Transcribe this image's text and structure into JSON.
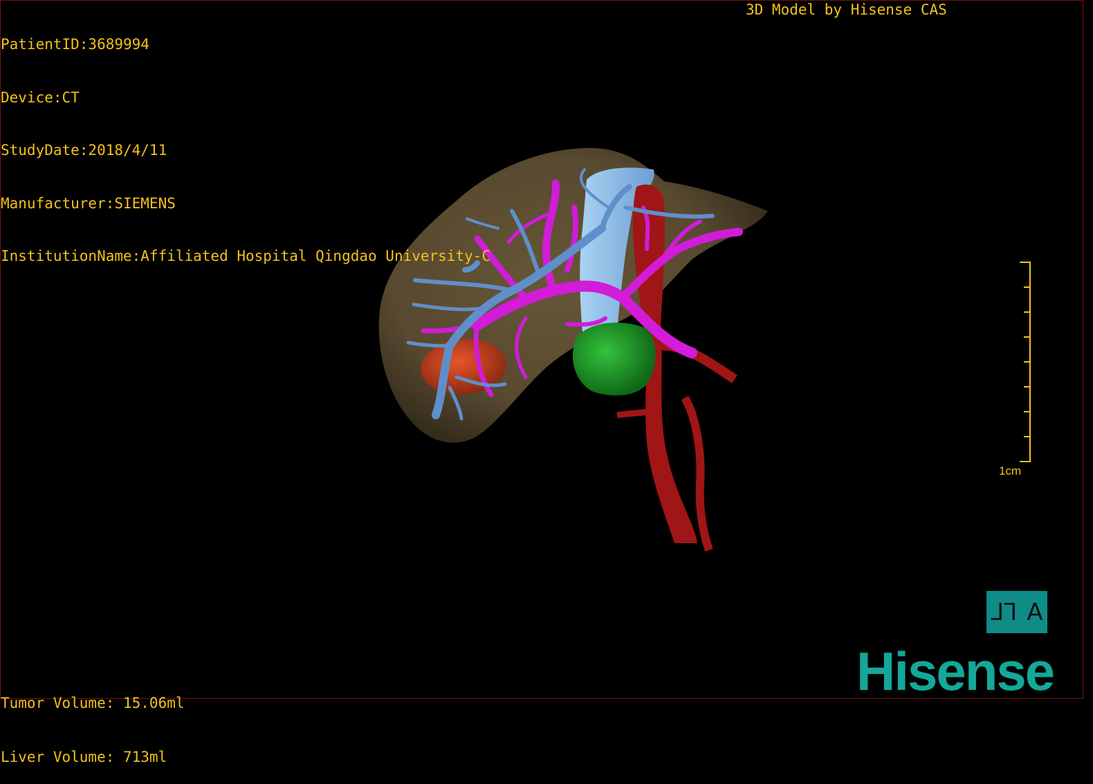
{
  "header": {
    "patient_id": "PatientID:3689994",
    "device": "Device:CT",
    "study_date": "StudyDate:2018/4/11",
    "manufacturer": "Manufacturer:SIEMENS",
    "institution": "InstitutionName:Affiliated Hospital Qingdao University-C"
  },
  "brand_top": "3D Model by Hisense CAS",
  "volumes": {
    "tumor": "Tumor Volume: 15.06ml",
    "liver": "Liver Volume: 713ml"
  },
  "scale_bar": {
    "label": "1cm"
  },
  "mode_button": {
    "left_glyph": "⅃Ꞁ",
    "right_glyph": "A"
  },
  "logo": "Hisense",
  "colors": {
    "overlay_text": "#f3c21a",
    "liver": "#6b5a3a",
    "portal_vein": "#d21cd8",
    "hepatic_vein": "#5f8fca",
    "artery": "#a01515",
    "tumor": "#1f9a2a",
    "lesion": "#d0401c",
    "logo": "#13a89a"
  }
}
